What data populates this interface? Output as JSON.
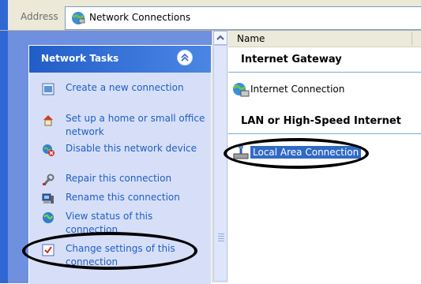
{
  "address_bar": {
    "label": "Address",
    "location_icon": "network-connections-icon",
    "value": "Network Connections"
  },
  "task_pane": {
    "title": "Network Tasks",
    "collapse_icon": "double-chevron-up-icon",
    "tasks": [
      {
        "label": "Create a new connection",
        "icon": "new-connection-icon"
      },
      {
        "label": "Set up a home or small office network",
        "icon": "home-network-icon"
      },
      {
        "label": "Disable this network device",
        "icon": "disable-device-icon"
      },
      {
        "label": "Repair this connection",
        "icon": "repair-wrench-icon"
      },
      {
        "label": "Rename this connection",
        "icon": "rename-icon"
      },
      {
        "label": "View status of this connection",
        "icon": "status-globe-icon"
      },
      {
        "label": "Change settings of this connection",
        "icon": "settings-checklist-icon"
      }
    ]
  },
  "content": {
    "column_header": "Name",
    "groups": [
      {
        "title": "Internet Gateway",
        "items": [
          {
            "label": "Internet Connection",
            "icon": "internet-connection-icon",
            "selected": false
          }
        ]
      },
      {
        "title": "LAN or High-Speed Internet",
        "items": [
          {
            "label": "Local Area Connection",
            "icon": "lan-connection-icon",
            "selected": true
          }
        ]
      }
    ]
  },
  "colors": {
    "task_link": "#215dc6",
    "selection": "#316ac5",
    "header_gradient_start": "#215dc6",
    "pane_background": "#6f8fdf"
  }
}
